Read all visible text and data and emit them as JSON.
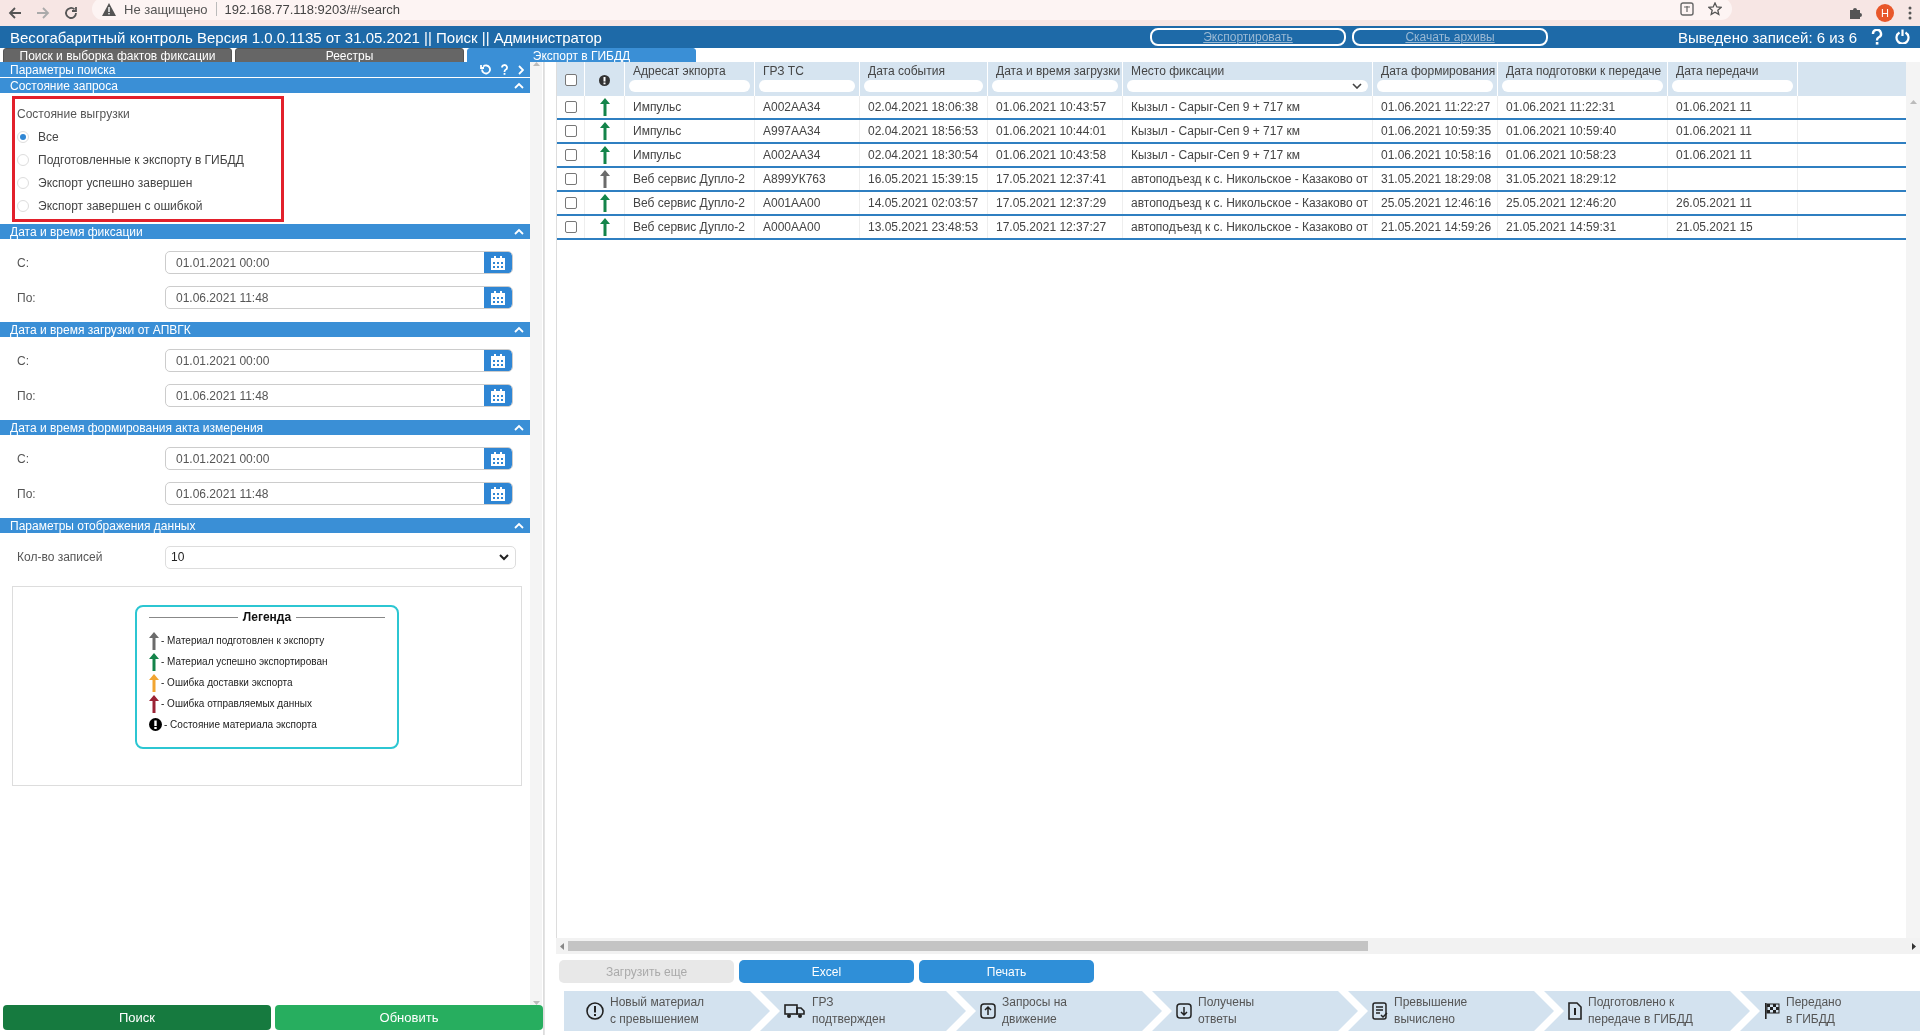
{
  "browser": {
    "security": "Не защищено",
    "url": "192.168.77.118:9203/#/search",
    "profile": "Н"
  },
  "header": {
    "title": "Весогабаритный контроль Версия 1.0.0.1135 от 31.05.2021 || Поиск || Администратор",
    "actions": [
      {
        "label": "Экспортировать",
        "disabled": true
      },
      {
        "label": "Скачать архивы",
        "disabled": true
      }
    ],
    "records": "Выведено записей: 6 из 6"
  },
  "tabs": [
    {
      "label": "Поиск и выборка фактов фиксации",
      "selected": false
    },
    {
      "label": "Реестры",
      "selected": false
    },
    {
      "label": "Экспорт в ГИБДД",
      "selected": true
    }
  ],
  "search_panel": {
    "title": "Параметры поиска",
    "sections": [
      {
        "kind": "radio",
        "title": "Состояние запроса",
        "highlighted": true,
        "group_label": "Состояние выгрузки",
        "options": [
          {
            "label": "Все",
            "selected": true
          },
          {
            "label": "Подготовленные к экспорту в ГИБДД",
            "selected": false
          },
          {
            "label": "Экспорт успешно завершен",
            "selected": false
          },
          {
            "label": "Экспорт завершен с ошибкой",
            "selected": false
          }
        ]
      },
      {
        "kind": "range",
        "title": "Дата и время фиксации",
        "rows": [
          {
            "label": "С:",
            "value": "01.01.2021 00:00"
          },
          {
            "label": "По:",
            "value": "01.06.2021 11:48"
          }
        ]
      },
      {
        "kind": "range",
        "title": "Дата и время загрузки от АПВГК",
        "rows": [
          {
            "label": "С:",
            "value": "01.01.2021 00:00"
          },
          {
            "label": "По:",
            "value": "01.06.2021 11:48"
          }
        ]
      },
      {
        "kind": "range",
        "title": "Дата и время формирования акта измерения",
        "rows": [
          {
            "label": "С:",
            "value": "01.01.2021 00:00"
          },
          {
            "label": "По:",
            "value": "01.06.2021 11:48"
          }
        ]
      },
      {
        "kind": "display",
        "title": "Параметры отображения данных",
        "field_label": "Кол-во записей",
        "value": "10"
      }
    ],
    "legend": {
      "title": "Легенда",
      "items": [
        {
          "kind": "prepared",
          "label": "- Материал подготовлен к экспорту"
        },
        {
          "kind": "exported",
          "label": "- Материал успешно экспортирован"
        },
        {
          "kind": "delivery_error",
          "label": "- Ошибка доставки экспорта"
        },
        {
          "kind": "data_error",
          "label": "- Ошибка отправляемых данных"
        },
        {
          "kind": "state",
          "label": "- Состояние материала экспорта"
        }
      ]
    },
    "buttons": [
      {
        "label": "Поиск",
        "kind": "primary"
      },
      {
        "label": "Обновить",
        "kind": "secondary"
      }
    ]
  },
  "grid": {
    "select_all_checked": false,
    "columns": [
      {
        "label": "Адресат экпорта",
        "kind": "text"
      },
      {
        "label": "ГРЗ ТС",
        "kind": "text"
      },
      {
        "label": "Дата события",
        "kind": "text"
      },
      {
        "label": "Дата и время загрузки",
        "kind": "text"
      },
      {
        "label": "Место фиксации",
        "kind": "select"
      },
      {
        "label": "Дата формирования",
        "kind": "text"
      },
      {
        "label": "Дата подготовки к передаче",
        "kind": "text"
      },
      {
        "label": "Дата передачи",
        "kind": "text"
      }
    ],
    "rows": [
      {
        "checked": false,
        "kind": "exported",
        "cells": [
          "Импульс",
          "А002АА34",
          "02.04.2021 18:06:38",
          "01.06.2021 10:43:57",
          "Кызыл - Сарыг-Сеп 9 + 717 км",
          "01.06.2021 11:22:27",
          "01.06.2021 11:22:31",
          "01.06.2021 11"
        ]
      },
      {
        "checked": false,
        "kind": "exported",
        "cells": [
          "Импульс",
          "А997АА34",
          "02.04.2021 18:56:53",
          "01.06.2021 10:44:01",
          "Кызыл - Сарыг-Сеп 9 + 717 км",
          "01.06.2021 10:59:35",
          "01.06.2021 10:59:40",
          "01.06.2021 11"
        ]
      },
      {
        "checked": false,
        "kind": "exported",
        "cells": [
          "Импульс",
          "А002АА34",
          "02.04.2021 18:30:54",
          "01.06.2021 10:43:58",
          "Кызыл - Сарыг-Сеп 9 + 717 км",
          "01.06.2021 10:58:16",
          "01.06.2021 10:58:23",
          "01.06.2021 11"
        ]
      },
      {
        "checked": false,
        "kind": "prepared",
        "cells": [
          "Веб сервис Дупло-2",
          "А899УК763",
          "16.05.2021 15:39:15",
          "17.05.2021 12:37:41",
          "автоподъезд к с. Никольское - Казаково от",
          "31.05.2021 18:29:08",
          "31.05.2021 18:29:12",
          ""
        ]
      },
      {
        "checked": false,
        "kind": "exported",
        "cells": [
          "Веб сервис Дупло-2",
          "А001АА00",
          "14.05.2021 02:03:57",
          "17.05.2021 12:37:29",
          "автоподъезд к с. Никольское - Казаково от",
          "25.05.2021 12:46:16",
          "25.05.2021 12:46:20",
          "26.05.2021 11"
        ]
      },
      {
        "checked": false,
        "kind": "exported",
        "cells": [
          "Веб сервис Дупло-2",
          "А000АА00",
          "13.05.2021 23:48:53",
          "17.05.2021 12:37:27",
          "автоподъезд к с. Никольское - Казаково от",
          "21.05.2021 14:59:26",
          "21.05.2021 14:59:31",
          "21.05.2021 15"
        ]
      }
    ],
    "buttons": [
      {
        "label": "Загрузить еще",
        "disabled": true
      },
      {
        "label": "Excel",
        "disabled": false
      },
      {
        "label": "Печать",
        "disabled": false
      }
    ]
  },
  "workflow": [
    {
      "kind": "alert",
      "lines": [
        "Новый материал",
        "с превышением"
      ]
    },
    {
      "kind": "truck",
      "lines": [
        "ГРЗ",
        "подтвержден"
      ]
    },
    {
      "kind": "upload",
      "lines": [
        "Запросы на",
        "движение"
      ]
    },
    {
      "kind": "download",
      "lines": [
        "Получены",
        "ответы"
      ]
    },
    {
      "kind": "document",
      "lines": [
        "Превышение",
        "вычислено"
      ]
    },
    {
      "kind": "file",
      "lines": [
        "Подготовлено к",
        "передаче в ГИБДД"
      ]
    },
    {
      "kind": "flag",
      "lines": [
        "Передано",
        "в ГИБДД"
      ]
    }
  ]
}
